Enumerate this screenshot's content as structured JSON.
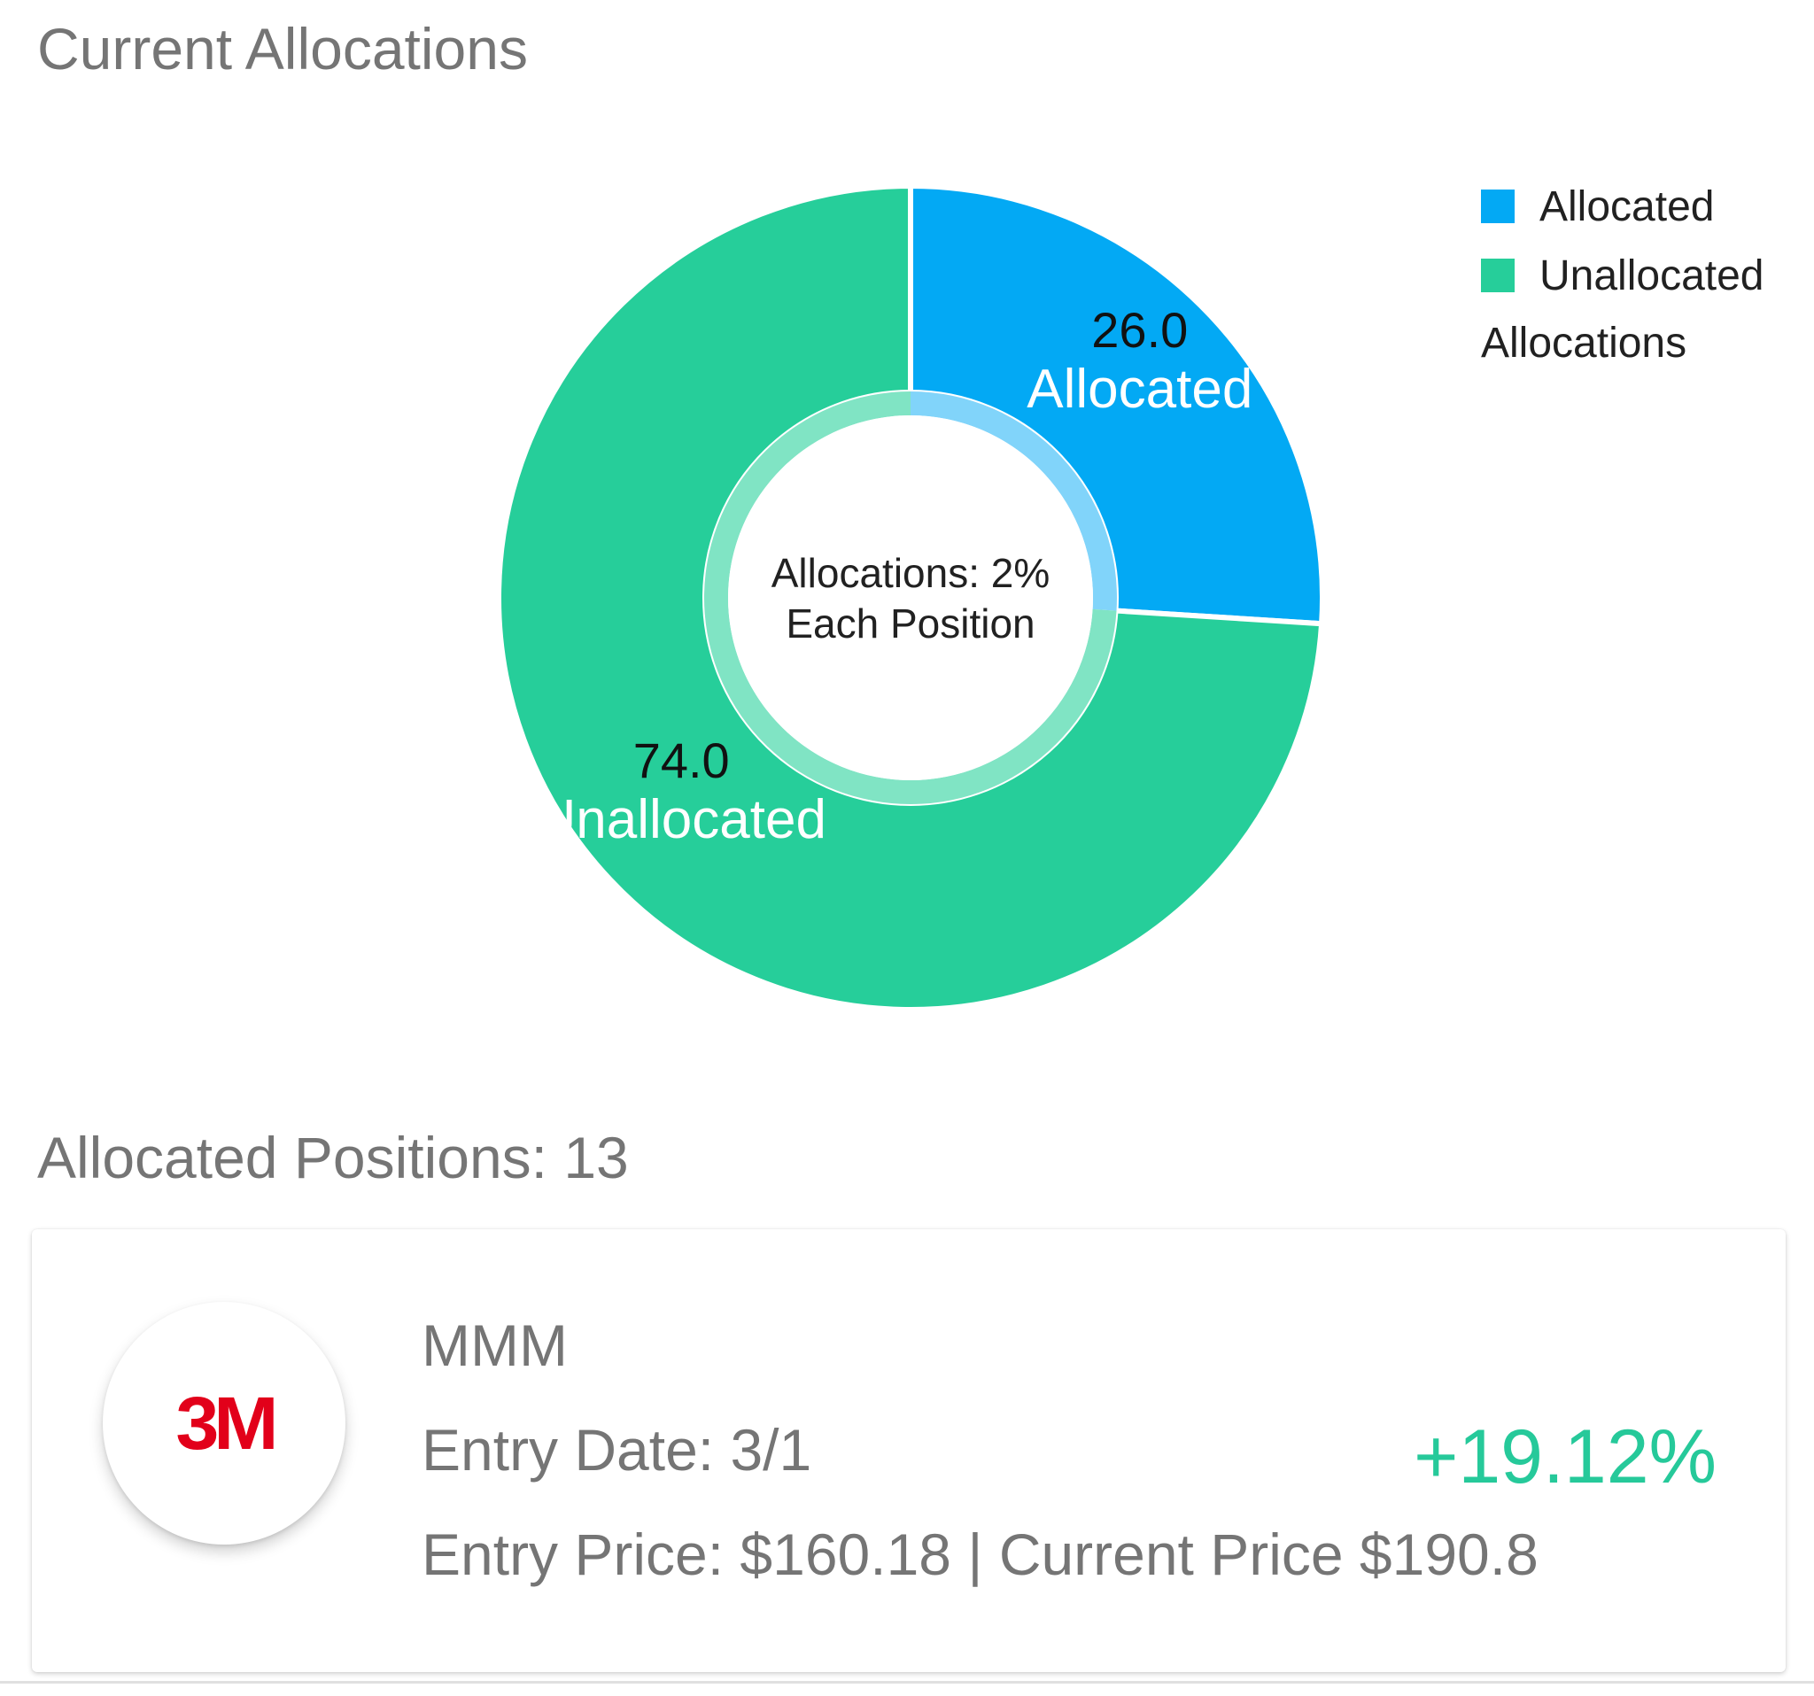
{
  "allocations_section": {
    "title": "Current Allocations"
  },
  "chart_data": {
    "type": "pie",
    "categories": [
      "Allocated",
      "Unallocated"
    ],
    "values": [
      26.0,
      74.0
    ],
    "value_labels": [
      "26.0",
      "74.0"
    ],
    "colors": [
      "#03a9f4",
      "#26ce9a"
    ],
    "inner_ring_colors": [
      "#81d4fa",
      "#80e4c4"
    ],
    "center_text": [
      "Allocations: 2%",
      "Each Position"
    ],
    "legend_title": "Allocations",
    "legend_placement": "top-right"
  },
  "positions_section": {
    "title": "Allocated Positions: 13"
  },
  "positions": [
    {
      "logo_text": "3M",
      "ticker": "MMM",
      "entry_date": "Entry Date: 3/1",
      "prices": "Entry Price: $160.18 | Current Price $190.8",
      "change": "+19.12%",
      "change_color": "#26c99a"
    }
  ]
}
